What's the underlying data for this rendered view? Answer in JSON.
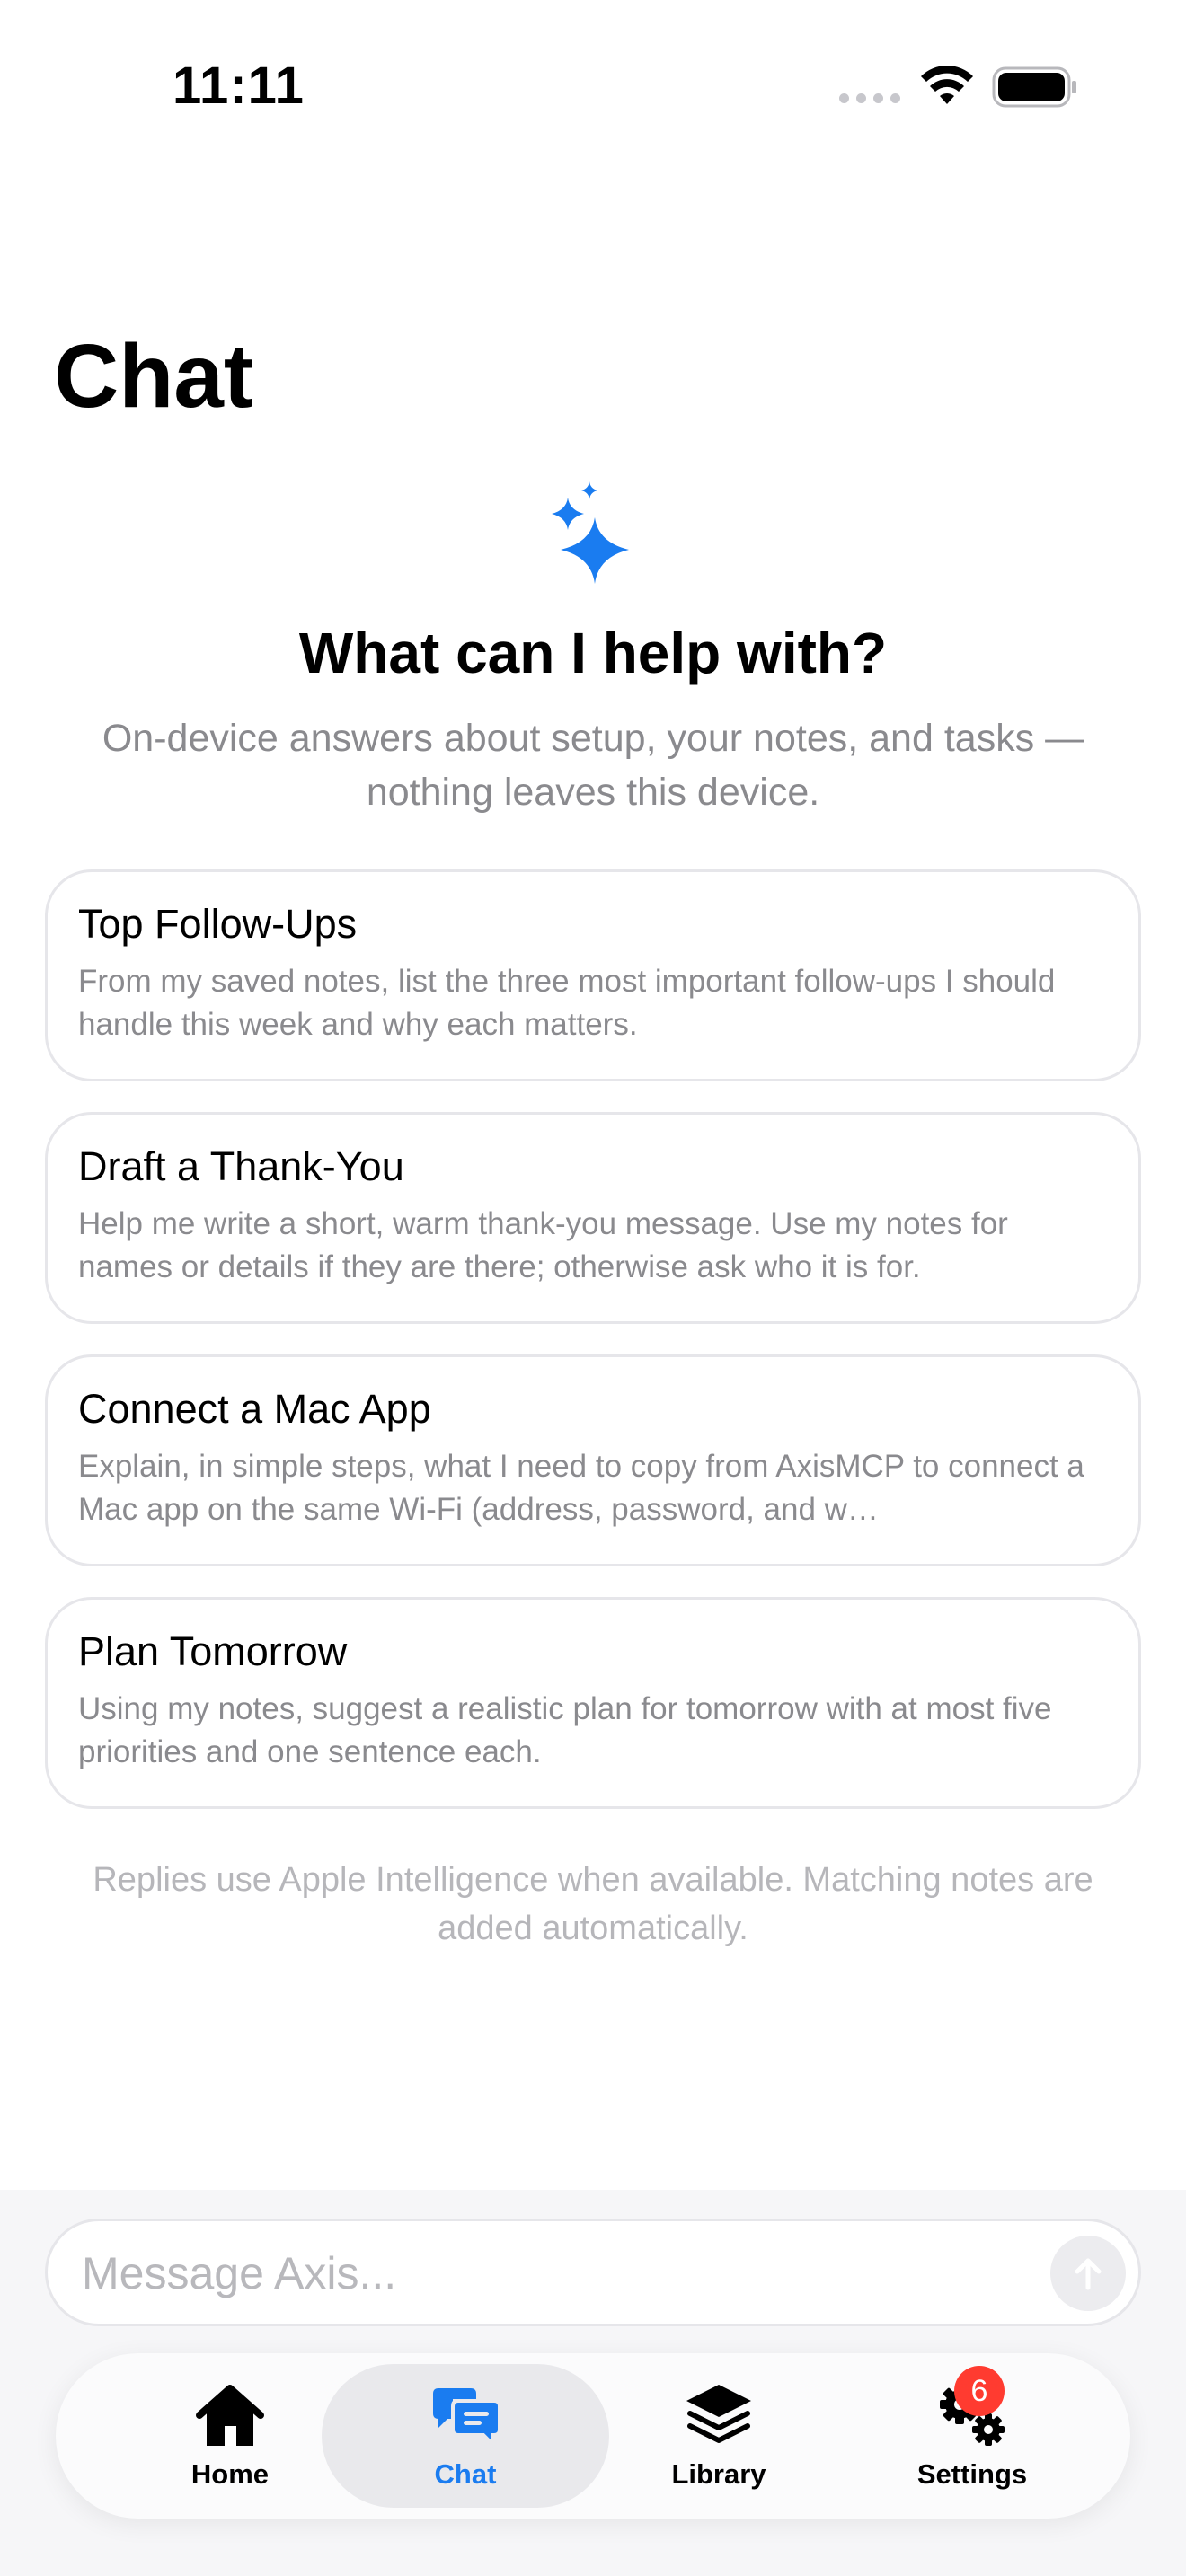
{
  "status_bar": {
    "time": "11:11"
  },
  "page": {
    "title": "Chat",
    "headline": "What can I help with?",
    "subhead": "On-device answers about setup, your notes, and tasks — nothing leaves this device."
  },
  "suggestions": [
    {
      "title": "Top Follow-Ups",
      "body": "From my saved notes, list the three most important follow-ups I should handle this week and why each matters."
    },
    {
      "title": "Draft a Thank-You",
      "body": "Help me write a short, warm thank-you message. Use my notes for names or details if they are there; otherwise ask who it is for."
    },
    {
      "title": "Connect a Mac App",
      "body": "Explain, in simple steps, what I need to copy from AxisMCP to connect a Mac app on the same Wi-Fi (address, password, and w…"
    },
    {
      "title": "Plan Tomorrow",
      "body": "Using my notes, suggest a realistic plan for tomorrow with at most five priorities and one sentence each."
    }
  ],
  "footnote": "Replies use Apple Intelligence when available. Matching notes are added automatically.",
  "composer": {
    "placeholder": "Message Axis...",
    "value": ""
  },
  "tabs": [
    {
      "label": "Home",
      "icon": "house-icon",
      "selected": false
    },
    {
      "label": "Chat",
      "icon": "chat-bubbles-icon",
      "selected": true
    },
    {
      "label": "Library",
      "icon": "stack-icon",
      "selected": false
    },
    {
      "label": "Settings",
      "icon": "gears-icon",
      "selected": false,
      "badge": "6"
    }
  ],
  "colors": {
    "accent": "#1a7cf0",
    "badge": "#ff3b30",
    "secondary_text": "#8a8a8e"
  }
}
